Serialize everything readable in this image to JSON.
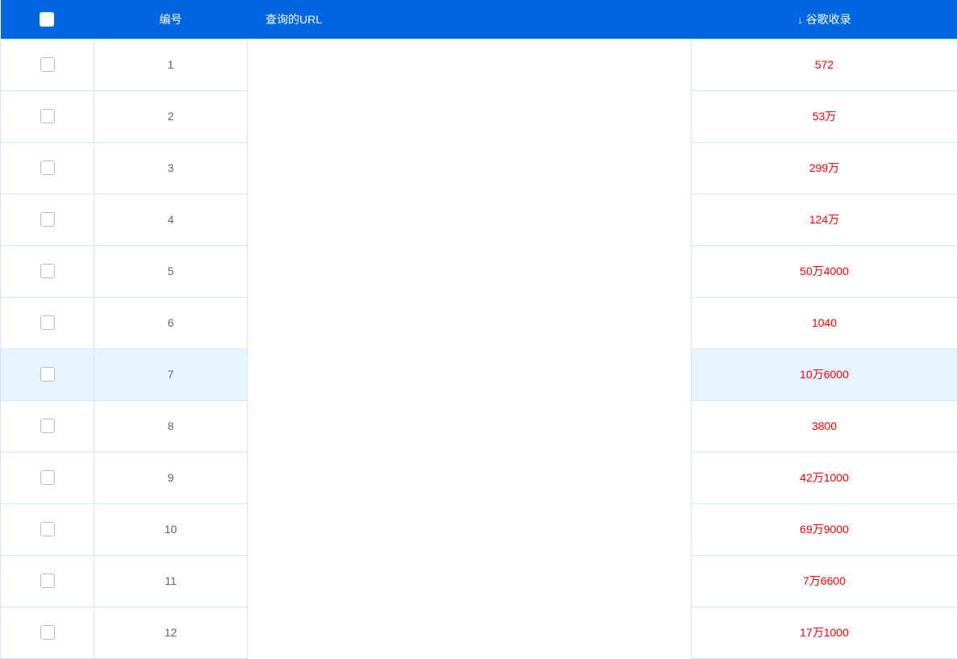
{
  "header": {
    "col_number": "编号",
    "col_url": "查询的URL",
    "col_index": "谷歌收录",
    "sort_indicator": "↓"
  },
  "rows": [
    {
      "num": "1",
      "index": "572",
      "highlight": false
    },
    {
      "num": "2",
      "index": "53万",
      "highlight": false
    },
    {
      "num": "3",
      "index": "299万",
      "highlight": false
    },
    {
      "num": "4",
      "index": "124万",
      "highlight": false
    },
    {
      "num": "5",
      "index": "50万4000",
      "highlight": false
    },
    {
      "num": "6",
      "index": "1040",
      "highlight": false
    },
    {
      "num": "7",
      "index": "10万6000",
      "highlight": true
    },
    {
      "num": "8",
      "index": "3800",
      "highlight": false
    },
    {
      "num": "9",
      "index": "42万1000",
      "highlight": false
    },
    {
      "num": "10",
      "index": "69万9000",
      "highlight": false
    },
    {
      "num": "11",
      "index": "7万6600",
      "highlight": false
    },
    {
      "num": "12",
      "index": "17万1000",
      "highlight": false
    }
  ]
}
